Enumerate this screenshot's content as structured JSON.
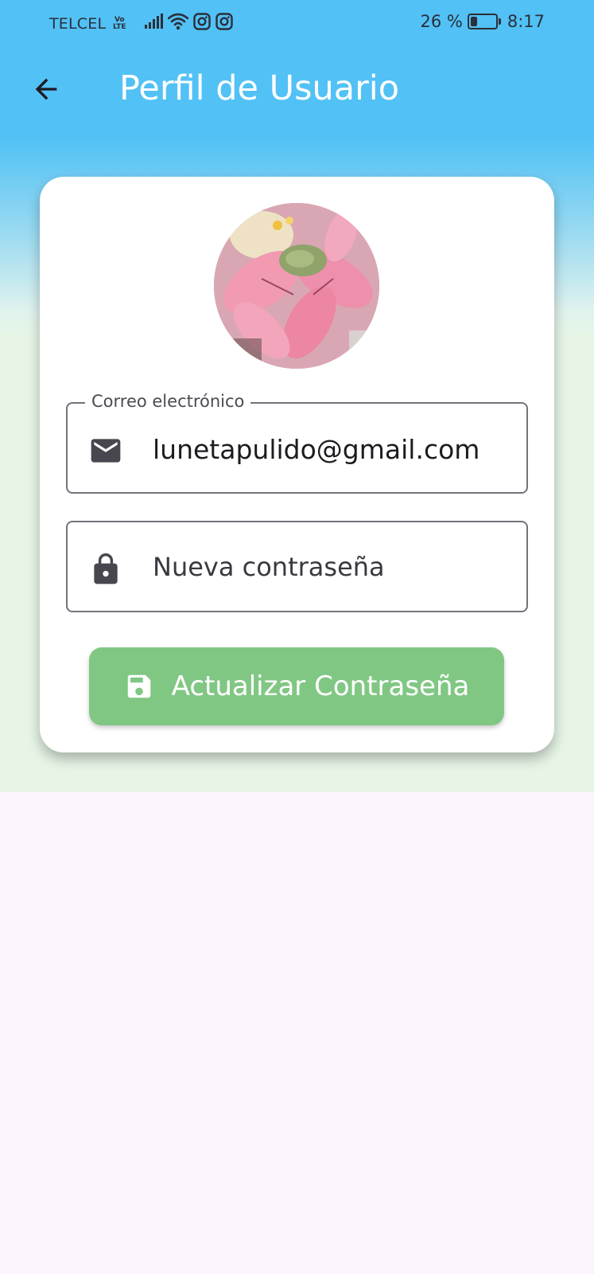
{
  "status_bar": {
    "carrier": "TELCEL",
    "volte_top": "Vo",
    "volte_bottom": "LTE",
    "battery_percent": "26 %",
    "battery_level": 0.26,
    "time": "8:17",
    "icons": [
      "signal-icon",
      "wifi-icon",
      "instagram-icon",
      "instagram-icon",
      "battery-icon"
    ]
  },
  "app_bar": {
    "title": "Perfil de Usuario",
    "back_icon": "arrow-back-icon",
    "background_color": "#52c1f5"
  },
  "profile": {
    "avatar_icon": "profile-photo"
  },
  "email_field": {
    "label": "Correo electrónico",
    "value": "lunetapulido@gmail.com",
    "icon": "mail-icon"
  },
  "password_field": {
    "placeholder": "Nueva contraseña",
    "value": "",
    "icon": "lock-icon"
  },
  "update_button": {
    "label": "Actualizar Contraseña",
    "icon": "save-icon",
    "color": "#81c784"
  },
  "colors": {
    "accent_blue": "#52c1f5",
    "accent_green": "#81c784",
    "lower_background": "#fcf5fd",
    "card_area_background": "#e6f5e6"
  }
}
